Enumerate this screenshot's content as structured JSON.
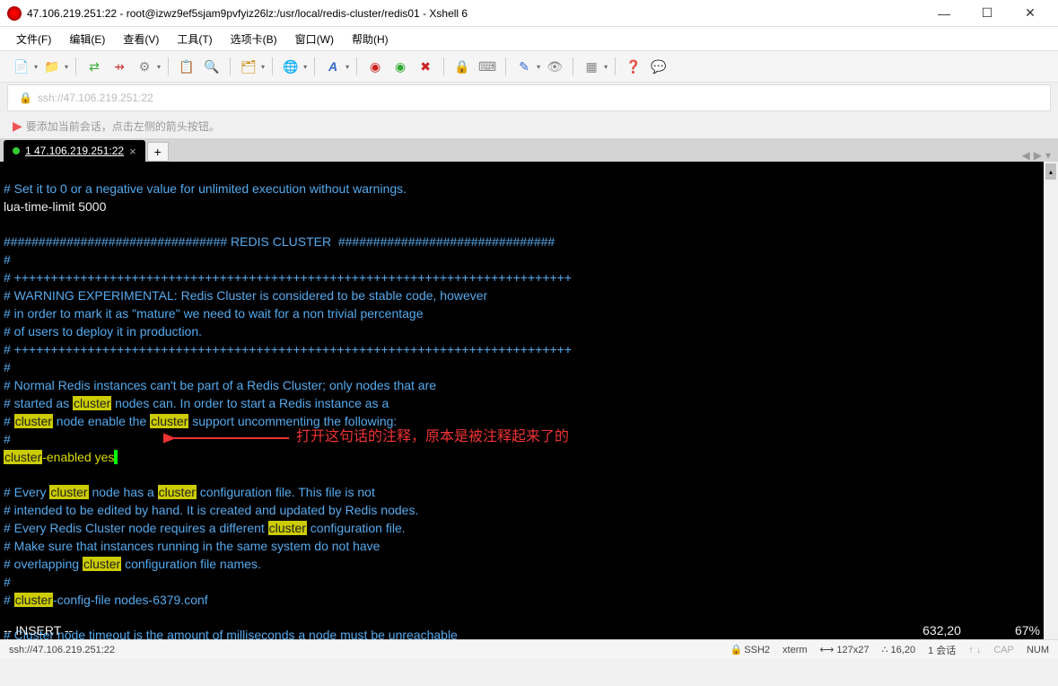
{
  "window": {
    "title": "47.106.219.251:22 - root@izwz9ef5sjam9pvfyiz26lz:/usr/local/redis-cluster/redis01 - Xshell 6",
    "min": "—",
    "max": "☐",
    "close": "✕"
  },
  "menu": {
    "file": "文件(F)",
    "edit": "编辑(E)",
    "view": "查看(V)",
    "tools": "工具(T)",
    "tabs": "选项卡(B)",
    "window": "窗口(W)",
    "help": "帮助(H)"
  },
  "address": {
    "url": "ssh://47.106.219.251:22"
  },
  "hint": {
    "text": "要添加当前会话，点击左侧的箭头按钮。"
  },
  "tab": {
    "label": "1 47.106.219.251:22",
    "close": "×",
    "add": "+"
  },
  "tabnav": {
    "left": "◀",
    "right": "▶",
    "drop": "▾"
  },
  "terminal": {
    "l1": "# Set it to 0 or a negative value for unlimited execution without warnings.",
    "l2": "lua-time-limit 5000",
    "l3a": "################################ REDIS CLUSTER  ###############################",
    "l4": "#",
    "l5": "# ++++++++++++++++++++++++++++++++++++++++++++++++++++++++++++++++++++++++++++",
    "l6": "# WARNING EXPERIMENTAL: Redis Cluster is considered to be stable code, however",
    "l7": "# in order to mark it as \"mature\" we need to wait for a non trivial percentage",
    "l8": "# of users to deploy it in production.",
    "l9": "# ++++++++++++++++++++++++++++++++++++++++++++++++++++++++++++++++++++++++++++",
    "l10": "#",
    "l11": "# Normal Redis instances can't be part of a Redis Cluster; only nodes that are",
    "l12a": "# started as ",
    "l12b": " nodes can. In order to start a Redis instance as a",
    "l13a": "# ",
    "l13b": " node enable the ",
    "l13c": " support uncommenting the following:",
    "l14": "#",
    "l15b": "-enabled yes",
    "l16": "# Every ",
    "l16b": " node has a ",
    "l16c": " configuration file. This file is not",
    "l17": "# intended to be edited by hand. It is created and updated by Redis nodes.",
    "l18a": "# Every Redis Cluster node requires a different ",
    "l18b": " configuration file.",
    "l19": "# Make sure that instances running in the same system do not have",
    "l20a": "# overlapping ",
    "l20b": " configuration file names.",
    "l21": "#",
    "l22a": "# ",
    "l22b": "-config-file nodes-6379.conf",
    "l23": "# Cluster node timeout is the amount of milliseconds a node must be unreachable",
    "hl_cluster": "cluster",
    "mode": "-- INSERT --",
    "pos": "632,20",
    "pct": "67%"
  },
  "annotation": "打开这句话的注释，原本是被注释起来了的",
  "status": {
    "path": "ssh://47.106.219.251:22",
    "ssh": "SSH2",
    "term": "xterm",
    "size": "127x27",
    "cursor": "16,20",
    "sessions": "1 会话",
    "cap": "CAP",
    "num": "NUM",
    "up": "↑",
    "down": "↓"
  },
  "icons": {
    "newdoc": "📄",
    "folder": "📁",
    "link": "🔗",
    "refresh": "🔄",
    "props": "⚙",
    "copy": "📋",
    "search": "🔍",
    "cfolder": "🗂",
    "globe": "🌐",
    "font": "A",
    "red": "◉",
    "grn": "◎",
    "x": "✖",
    "lock": "🔒",
    "mail": "📧",
    "edit": "✎",
    "view": "👁",
    "grid": "▦",
    "help": "❓",
    "chat": "💬",
    "drop": "▾"
  }
}
